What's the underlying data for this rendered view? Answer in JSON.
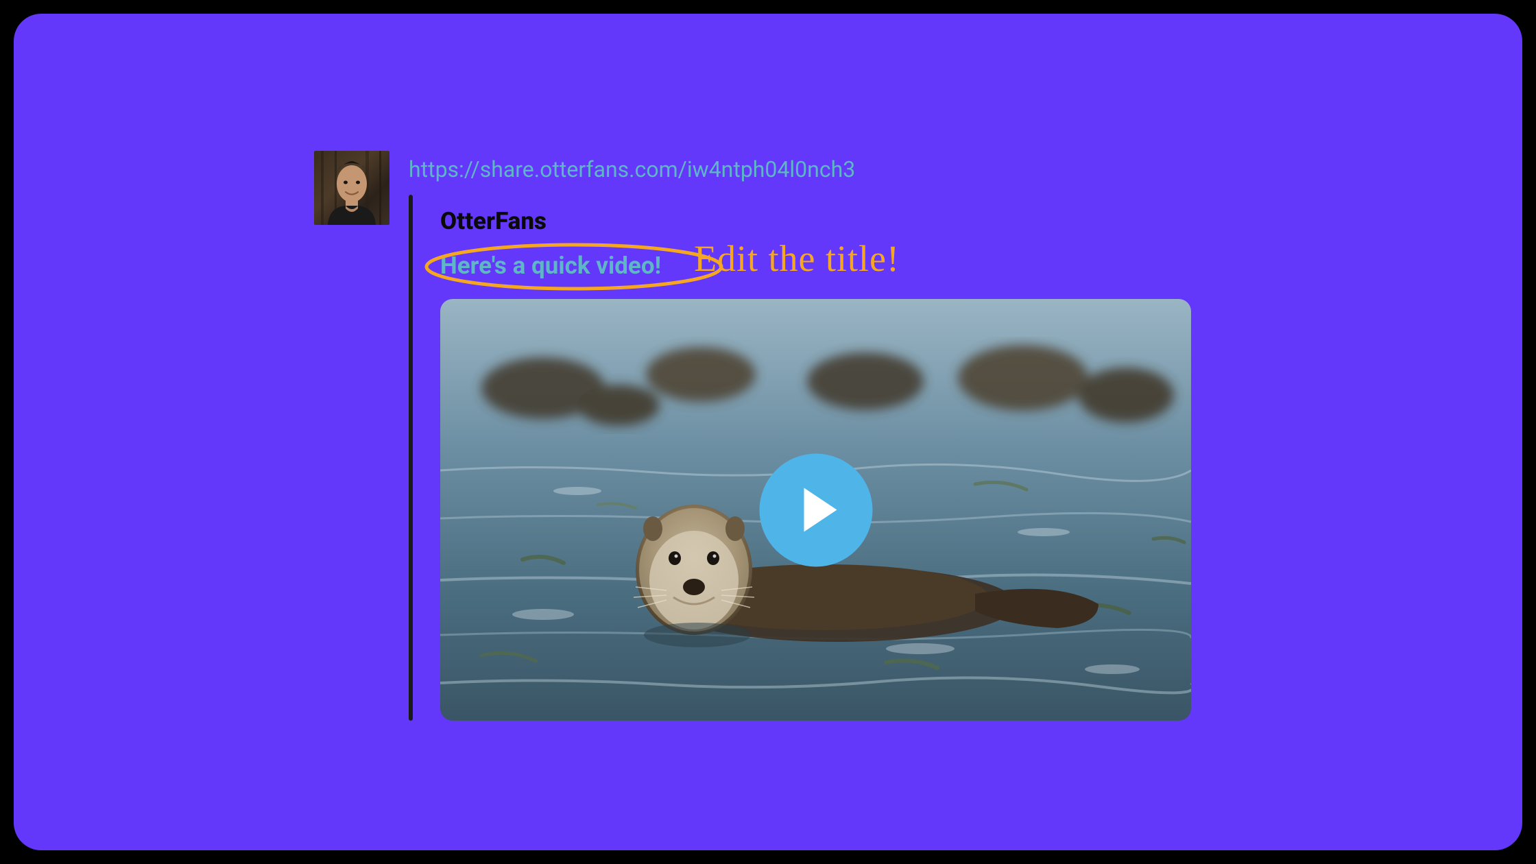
{
  "message": {
    "url": "https://share.otterfans.com/iw4ntph04l0nch3",
    "site_name": "OtterFans",
    "title": "Here's a quick video!"
  },
  "annotation": {
    "note": "Edit the title!"
  },
  "colors": {
    "background": "#6338FA",
    "link": "#5EB6C7",
    "annotation": "#F5A623",
    "play_button": "#4FB4E8"
  }
}
